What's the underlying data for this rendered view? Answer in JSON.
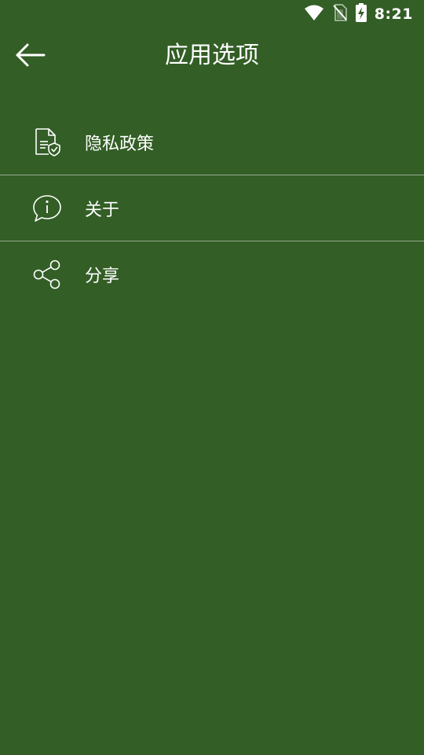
{
  "status_bar": {
    "time": "8:21",
    "icons": [
      "wifi-icon",
      "no-sim-icon",
      "battery-charging-icon"
    ]
  },
  "app_bar": {
    "back_icon": "arrow-left-icon",
    "title": "应用选项"
  },
  "menu": {
    "items": [
      {
        "label": "隐私政策",
        "icon": "privacy-document-icon"
      },
      {
        "label": "关于",
        "icon": "info-chat-icon"
      },
      {
        "label": "分享",
        "icon": "share-icon"
      }
    ]
  },
  "colors": {
    "background": "#335e26",
    "text": "#ffffff",
    "divider": "#a7b8a2"
  }
}
